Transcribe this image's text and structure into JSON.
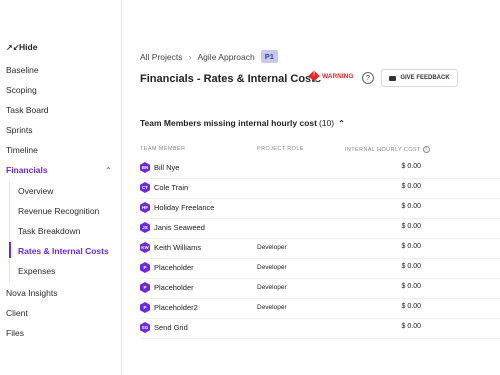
{
  "sidebar": {
    "hide_label": "Hide",
    "items": [
      {
        "label": "Baseline"
      },
      {
        "label": "Scoping"
      },
      {
        "label": "Task Board"
      },
      {
        "label": "Sprints"
      },
      {
        "label": "Timeline"
      },
      {
        "label": "Financials"
      }
    ],
    "financials_sub": [
      {
        "label": "Overview"
      },
      {
        "label": "Revenue Recognition"
      },
      {
        "label": "Task Breakdown"
      },
      {
        "label": "Rates & Internal Costs"
      },
      {
        "label": "Expenses"
      }
    ],
    "items_after": [
      {
        "label": "Nova Insights"
      },
      {
        "label": "Client"
      },
      {
        "label": "Files"
      }
    ],
    "accent_color": "#6c2bd9"
  },
  "breadcrumb": {
    "all_projects": "All Projects",
    "project": "Agile Approach",
    "badge": "P1"
  },
  "header": {
    "title": "Financials - Rates & Internal Costs",
    "warning_label": "WARNING",
    "help_icon": "?",
    "feedback_label": "GIVE FEEDBACK"
  },
  "section": {
    "title": "Team Members missing internal hourly cost",
    "count": "(10)"
  },
  "table": {
    "columns": [
      "TEAM MEMBER",
      "PROJECT ROLE",
      "INTERNAL HOURLY COST"
    ],
    "rows": [
      {
        "initials": "BN",
        "name": "Bill Nye",
        "role": "",
        "cost": "$ 0.00"
      },
      {
        "initials": "CT",
        "name": "Cole Train",
        "role": "",
        "cost": "$ 0.00"
      },
      {
        "initials": "HF",
        "name": "Holiday Freelance",
        "role": "",
        "cost": "$ 0.00"
      },
      {
        "initials": "JS",
        "name": "Janis Seaweed",
        "role": "",
        "cost": "$ 0.00"
      },
      {
        "initials": "KW",
        "name": "Keith Williams",
        "role": "Developer",
        "cost": "$ 0.00"
      },
      {
        "initials": "P",
        "name": "Placeholder",
        "role": "Developer",
        "cost": "$ 0.00"
      },
      {
        "initials": "P",
        "name": "Placeholder",
        "role": "Developer",
        "cost": "$ 0.00"
      },
      {
        "initials": "P",
        "name": "Placeholder2",
        "role": "Developer",
        "cost": "$ 0.00"
      },
      {
        "initials": "SG",
        "name": "Send Grid",
        "role": "",
        "cost": "$ 0.00"
      }
    ]
  }
}
